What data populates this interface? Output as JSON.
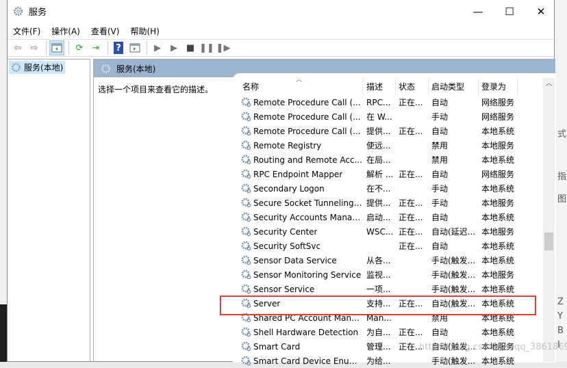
{
  "window": {
    "title": "服务",
    "minimize": "—",
    "maximize": "☐",
    "close": "✕"
  },
  "menu": [
    "文件(F)",
    "操作(A)",
    "查看(V)",
    "帮助(H)"
  ],
  "tree": {
    "root": "服务(本地)"
  },
  "panel": {
    "title": "服务(本地)",
    "description_hint": "选择一个项目来查看它的描述。"
  },
  "columns": [
    "名称",
    "描述",
    "状态",
    "启动类型",
    "登录为"
  ],
  "rows": [
    [
      "Remote Procedure Call (...",
      "RPC...",
      "正在...",
      "自动",
      "网络服务"
    ],
    [
      "Remote Procedure Call (...",
      "在 W...",
      "",
      "手动",
      "网络服务"
    ],
    [
      "Remote Procedure Call (...",
      "提供...",
      "正在...",
      "自动",
      "本地系统"
    ],
    [
      "Remote Registry",
      "使远...",
      "",
      "禁用",
      "本地服务"
    ],
    [
      "Routing and Remote Acc...",
      "在局...",
      "",
      "禁用",
      "本地系统"
    ],
    [
      "RPC Endpoint Mapper",
      "解析 ...",
      "正在...",
      "自动",
      "网络服务"
    ],
    [
      "Secondary Logon",
      "在不...",
      "",
      "手动",
      "本地系统"
    ],
    [
      "Secure Socket Tunneling ...",
      "提供...",
      "正在...",
      "手动",
      "本地服务"
    ],
    [
      "Security Accounts Manag...",
      "启动...",
      "正在...",
      "自动",
      "本地系统"
    ],
    [
      "Security Center",
      "WSC...",
      "正在...",
      "自动(延迟...",
      "本地服务"
    ],
    [
      "Security SoftSvc",
      "",
      "正在...",
      "自动",
      "本地系统"
    ],
    [
      "Sensor Data Service",
      "从各...",
      "",
      "手动(触发...",
      "本地系统"
    ],
    [
      "Sensor Monitoring Service",
      "监视...",
      "",
      "手动(触发...",
      "本地服务"
    ],
    [
      "Sensor Service",
      "一项...",
      "",
      "手动(触发...",
      "本地系统"
    ],
    [
      "Server",
      "支持...",
      "正在...",
      "自动(触发...",
      "本地系统"
    ],
    [
      "Shared PC Account Mana...",
      "Man...",
      "",
      "禁用",
      "本地系统"
    ],
    [
      "Shell Hardware Detection",
      "为自...",
      "正在...",
      "自动",
      "本地系统"
    ],
    [
      "Smart Card",
      "管理...",
      "正在...",
      "自动(触发...",
      "本地服务"
    ],
    [
      "Smart Card Device Enum...",
      "为给...",
      "",
      "手动(触发...",
      "本地系统"
    ]
  ],
  "highlighted_row": "Server",
  "highlight_color": "#e53935",
  "watermark": "https://blog.csdn.net/qq_38618691",
  "background_glyphs": [
    "式",
    "指",
    "图",
    "Z",
    "Y",
    "B",
    "I"
  ]
}
